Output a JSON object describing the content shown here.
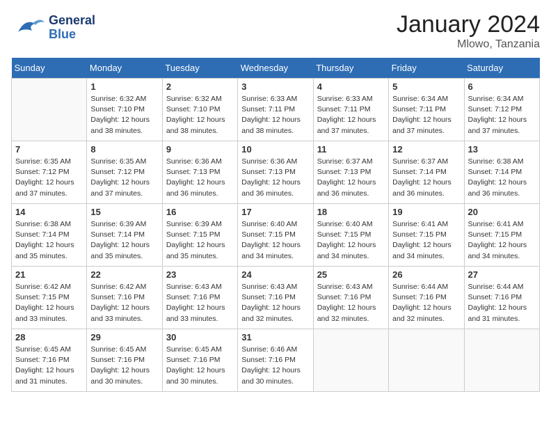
{
  "header": {
    "logo_line1": "General",
    "logo_line2": "Blue",
    "month_year": "January 2024",
    "location": "Mlowo, Tanzania"
  },
  "weekdays": [
    "Sunday",
    "Monday",
    "Tuesday",
    "Wednesday",
    "Thursday",
    "Friday",
    "Saturday"
  ],
  "weeks": [
    [
      {
        "day": "",
        "info": ""
      },
      {
        "day": "1",
        "info": "Sunrise: 6:32 AM\nSunset: 7:10 PM\nDaylight: 12 hours\nand 38 minutes."
      },
      {
        "day": "2",
        "info": "Sunrise: 6:32 AM\nSunset: 7:10 PM\nDaylight: 12 hours\nand 38 minutes."
      },
      {
        "day": "3",
        "info": "Sunrise: 6:33 AM\nSunset: 7:11 PM\nDaylight: 12 hours\nand 38 minutes."
      },
      {
        "day": "4",
        "info": "Sunrise: 6:33 AM\nSunset: 7:11 PM\nDaylight: 12 hours\nand 37 minutes."
      },
      {
        "day": "5",
        "info": "Sunrise: 6:34 AM\nSunset: 7:11 PM\nDaylight: 12 hours\nand 37 minutes."
      },
      {
        "day": "6",
        "info": "Sunrise: 6:34 AM\nSunset: 7:12 PM\nDaylight: 12 hours\nand 37 minutes."
      }
    ],
    [
      {
        "day": "7",
        "info": "Sunrise: 6:35 AM\nSunset: 7:12 PM\nDaylight: 12 hours\nand 37 minutes."
      },
      {
        "day": "8",
        "info": "Sunrise: 6:35 AM\nSunset: 7:12 PM\nDaylight: 12 hours\nand 37 minutes."
      },
      {
        "day": "9",
        "info": "Sunrise: 6:36 AM\nSunset: 7:13 PM\nDaylight: 12 hours\nand 36 minutes."
      },
      {
        "day": "10",
        "info": "Sunrise: 6:36 AM\nSunset: 7:13 PM\nDaylight: 12 hours\nand 36 minutes."
      },
      {
        "day": "11",
        "info": "Sunrise: 6:37 AM\nSunset: 7:13 PM\nDaylight: 12 hours\nand 36 minutes."
      },
      {
        "day": "12",
        "info": "Sunrise: 6:37 AM\nSunset: 7:14 PM\nDaylight: 12 hours\nand 36 minutes."
      },
      {
        "day": "13",
        "info": "Sunrise: 6:38 AM\nSunset: 7:14 PM\nDaylight: 12 hours\nand 36 minutes."
      }
    ],
    [
      {
        "day": "14",
        "info": "Sunrise: 6:38 AM\nSunset: 7:14 PM\nDaylight: 12 hours\nand 35 minutes."
      },
      {
        "day": "15",
        "info": "Sunrise: 6:39 AM\nSunset: 7:14 PM\nDaylight: 12 hours\nand 35 minutes."
      },
      {
        "day": "16",
        "info": "Sunrise: 6:39 AM\nSunset: 7:15 PM\nDaylight: 12 hours\nand 35 minutes."
      },
      {
        "day": "17",
        "info": "Sunrise: 6:40 AM\nSunset: 7:15 PM\nDaylight: 12 hours\nand 34 minutes."
      },
      {
        "day": "18",
        "info": "Sunrise: 6:40 AM\nSunset: 7:15 PM\nDaylight: 12 hours\nand 34 minutes."
      },
      {
        "day": "19",
        "info": "Sunrise: 6:41 AM\nSunset: 7:15 PM\nDaylight: 12 hours\nand 34 minutes."
      },
      {
        "day": "20",
        "info": "Sunrise: 6:41 AM\nSunset: 7:15 PM\nDaylight: 12 hours\nand 34 minutes."
      }
    ],
    [
      {
        "day": "21",
        "info": "Sunrise: 6:42 AM\nSunset: 7:15 PM\nDaylight: 12 hours\nand 33 minutes."
      },
      {
        "day": "22",
        "info": "Sunrise: 6:42 AM\nSunset: 7:16 PM\nDaylight: 12 hours\nand 33 minutes."
      },
      {
        "day": "23",
        "info": "Sunrise: 6:43 AM\nSunset: 7:16 PM\nDaylight: 12 hours\nand 33 minutes."
      },
      {
        "day": "24",
        "info": "Sunrise: 6:43 AM\nSunset: 7:16 PM\nDaylight: 12 hours\nand 32 minutes."
      },
      {
        "day": "25",
        "info": "Sunrise: 6:43 AM\nSunset: 7:16 PM\nDaylight: 12 hours\nand 32 minutes."
      },
      {
        "day": "26",
        "info": "Sunrise: 6:44 AM\nSunset: 7:16 PM\nDaylight: 12 hours\nand 32 minutes."
      },
      {
        "day": "27",
        "info": "Sunrise: 6:44 AM\nSunset: 7:16 PM\nDaylight: 12 hours\nand 31 minutes."
      }
    ],
    [
      {
        "day": "28",
        "info": "Sunrise: 6:45 AM\nSunset: 7:16 PM\nDaylight: 12 hours\nand 31 minutes."
      },
      {
        "day": "29",
        "info": "Sunrise: 6:45 AM\nSunset: 7:16 PM\nDaylight: 12 hours\nand 30 minutes."
      },
      {
        "day": "30",
        "info": "Sunrise: 6:45 AM\nSunset: 7:16 PM\nDaylight: 12 hours\nand 30 minutes."
      },
      {
        "day": "31",
        "info": "Sunrise: 6:46 AM\nSunset: 7:16 PM\nDaylight: 12 hours\nand 30 minutes."
      },
      {
        "day": "",
        "info": ""
      },
      {
        "day": "",
        "info": ""
      },
      {
        "day": "",
        "info": ""
      }
    ]
  ]
}
